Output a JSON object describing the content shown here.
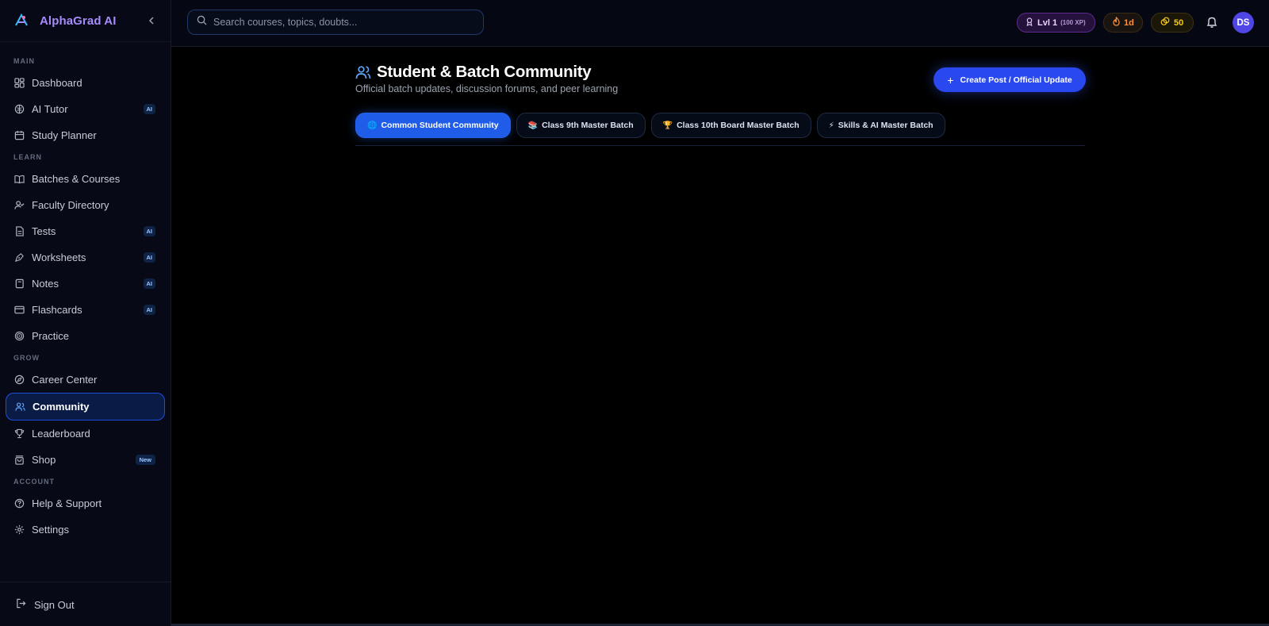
{
  "brand": {
    "name": "AlphaGrad AI"
  },
  "search": {
    "placeholder": "Search courses, topics, doubts..."
  },
  "topbar": {
    "level_label": "Lvl 1",
    "level_xp": "(100 XP)",
    "streak": "1d",
    "coins": "50",
    "avatar_initials": "DS"
  },
  "sidebar": {
    "sections": {
      "main": "MAIN",
      "learn": "LEARN",
      "grow": "GROW",
      "account": "ACCOUNT"
    },
    "items": {
      "dashboard": "Dashboard",
      "ai_tutor": "AI Tutor",
      "study_planner": "Study Planner",
      "batches": "Batches & Courses",
      "faculty": "Faculty Directory",
      "tests": "Tests",
      "worksheets": "Worksheets",
      "notes": "Notes",
      "flashcards": "Flashcards",
      "practice": "Practice",
      "career": "Career Center",
      "community": "Community",
      "leaderboard": "Leaderboard",
      "shop": "Shop",
      "help": "Help & Support",
      "settings": "Settings"
    },
    "badges": {
      "ai": "AI",
      "new": "New"
    },
    "sign_out": "Sign Out"
  },
  "main": {
    "title": "Student & Batch Community",
    "subtitle": "Official batch updates, discussion forums, and peer learning",
    "create_button": "Create Post / Official Update",
    "tabs": [
      {
        "emoji": "🌐",
        "label": "Common Student Community"
      },
      {
        "emoji": "📚",
        "label": "Class 9th Master Batch"
      },
      {
        "emoji": "🏆",
        "label": "Class 10th Board Master Batch"
      },
      {
        "emoji": "⚡",
        "label": "Skills & AI Master Batch"
      }
    ]
  },
  "colors": {
    "accent": "#2948f0",
    "active_tab": "#1f5ce8",
    "brand_text": "#a78bfa",
    "level_pill": "#24113c",
    "streak": "#fb923c",
    "coins": "#facc15"
  }
}
